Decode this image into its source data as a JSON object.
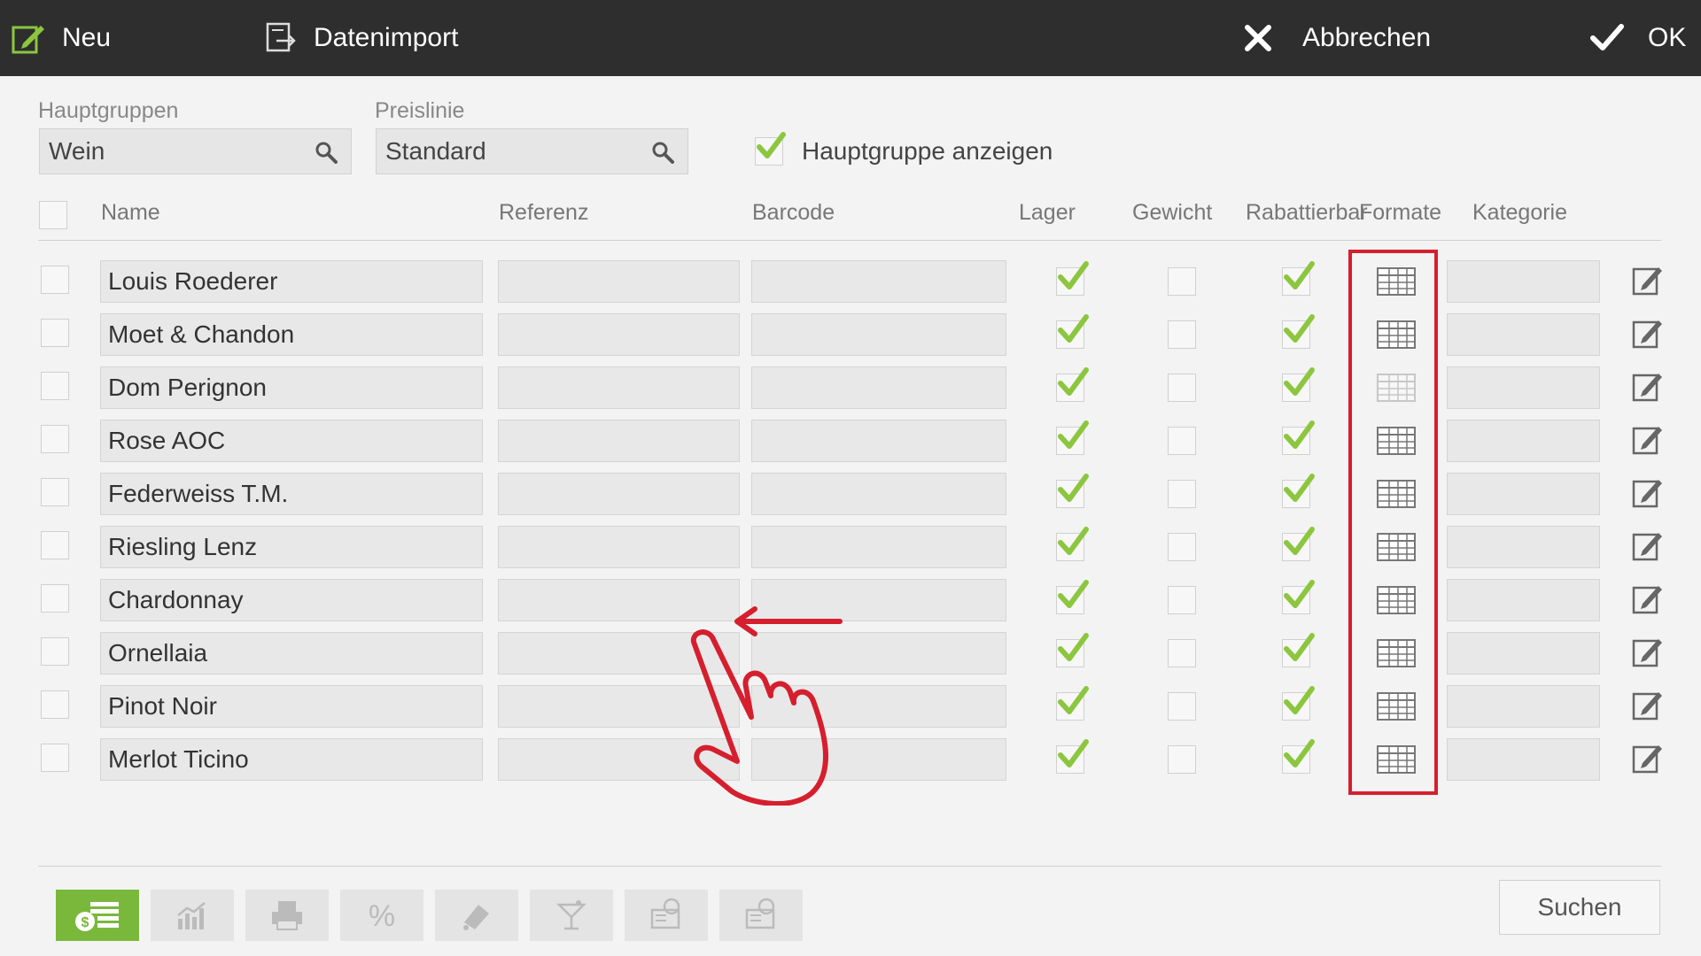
{
  "toolbar": {
    "new_label": "Neu",
    "import_label": "Datenimport",
    "cancel_label": "Abbrechen",
    "ok_label": "OK"
  },
  "filters": {
    "hauptgruppen_label": "Hauptgruppen",
    "hauptgruppen_value": "Wein",
    "preislinie_label": "Preislinie",
    "preislinie_value": "Standard",
    "show_group_label": "Hauptgruppe anzeigen",
    "show_group_checked": true
  },
  "columns": {
    "name": "Name",
    "referenz": "Referenz",
    "barcode": "Barcode",
    "lager": "Lager",
    "gewicht": "Gewicht",
    "rabattierbar": "Rabattierbar",
    "formate": "Formate",
    "kategorie": "Kategorie"
  },
  "rows": [
    {
      "name": "Louis Roederer",
      "lager": true,
      "gewicht": false,
      "rabattierbar": true
    },
    {
      "name": "Moet & Chandon",
      "lager": true,
      "gewicht": false,
      "rabattierbar": true
    },
    {
      "name": "Dom Perignon",
      "lager": true,
      "gewicht": false,
      "rabattierbar": true
    },
    {
      "name": "Rose AOC",
      "lager": true,
      "gewicht": false,
      "rabattierbar": true
    },
    {
      "name": "Federweiss T.M.",
      "lager": true,
      "gewicht": false,
      "rabattierbar": true
    },
    {
      "name": "Riesling Lenz",
      "lager": true,
      "gewicht": false,
      "rabattierbar": true
    },
    {
      "name": "Chardonnay",
      "lager": true,
      "gewicht": false,
      "rabattierbar": true
    },
    {
      "name": "Ornellaia",
      "lager": true,
      "gewicht": false,
      "rabattierbar": true
    },
    {
      "name": "Pinot Noir",
      "lager": true,
      "gewicht": false,
      "rabattierbar": true
    },
    {
      "name": "Merlot Ticino",
      "lager": true,
      "gewicht": false,
      "rabattierbar": true
    }
  ],
  "footer": {
    "search_label": "Suchen",
    "tabs": [
      "price-list-icon",
      "chart-icon",
      "printer-icon",
      "percent-icon",
      "eraser-icon",
      "cocktail-icon",
      "cash-register-icon",
      "cash-register-2-icon"
    ]
  },
  "colors": {
    "accent_green": "#7ab83c",
    "highlight_red": "#d51f2e",
    "topbar": "#2e2e2e"
  }
}
